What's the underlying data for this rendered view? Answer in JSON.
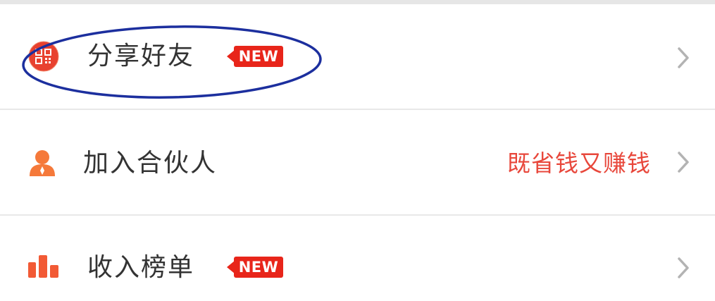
{
  "menu": {
    "items": [
      {
        "label": "分享好友",
        "badge": "NEW",
        "icon": "share-qr-icon"
      },
      {
        "label": "加入合伙人",
        "promo": "既省钱又赚钱",
        "icon": "partner-person-icon"
      },
      {
        "label": "收入榜单",
        "badge": "NEW",
        "icon": "ranking-bar-chart-icon"
      }
    ]
  },
  "colors": {
    "badge": "#e8251a",
    "promo": "#e8473b",
    "label": "#333333",
    "chevron": "#b3b3b3",
    "icon_orange": "#f5793a",
    "highlight_ellipse": "#1c2f9e"
  }
}
